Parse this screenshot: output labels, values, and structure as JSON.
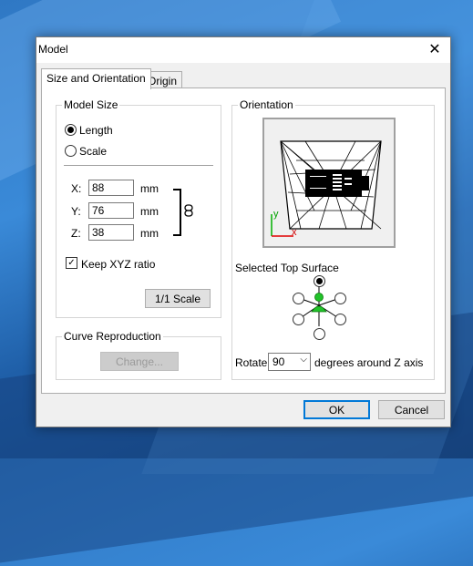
{
  "dialog": {
    "title": "Model",
    "close_glyph": "✕",
    "tabs": [
      "Size and Orientation",
      "Origin"
    ],
    "model_size": {
      "group_label": "Model Size",
      "length_label": "Length",
      "scale_label": "Scale",
      "selected_option": "Length",
      "x_label": "X:",
      "x_value": "88",
      "x_unit": "mm",
      "y_label": "Y:",
      "y_value": "76",
      "y_unit": "mm",
      "z_label": "Z:",
      "z_value": "38",
      "z_unit": "mm",
      "link_icon": "chain-link-icon",
      "keep_ratio_label": "Keep XYZ ratio",
      "keep_ratio_checked": true,
      "reset_button": "1/1 Scale"
    },
    "curve": {
      "group_label": "Curve Reproduction",
      "change_button": "Change..."
    },
    "orientation": {
      "group_label": "Orientation",
      "preview_icon": "model-wireframe-preview",
      "axis_y": "y",
      "axis_x": "x",
      "top_surface_label": "Selected Top Surface",
      "selected_surface": "top",
      "rotate_label": "Rotate",
      "rotate_value": "90",
      "rotate_suffix": "degrees around Z axis"
    },
    "ok_button": "OK",
    "cancel_button": "Cancel"
  }
}
